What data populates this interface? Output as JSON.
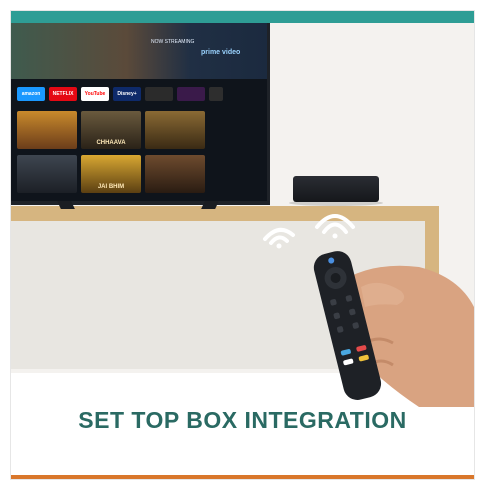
{
  "banner": {
    "title": "SET TOP BOX INTEGRATION"
  },
  "tv_screen": {
    "apps": [
      "amazon",
      "NETFLIX",
      "YouTube",
      "Disney+",
      "",
      "",
      ""
    ],
    "tiles_row1": [
      "",
      "CHHAAVA",
      ""
    ],
    "tiles_row2": [
      "",
      "JAI BHIM",
      ""
    ],
    "hero_text": "NOW STREAMING",
    "hero_brand": "prime video"
  },
  "colors": {
    "top_band": "#2e9d95",
    "bottom_band": "#d9772b",
    "title": "#2a6a63",
    "netflix": "#e50914",
    "youtube": "#ff0000"
  },
  "icons": [
    "wifi-signal-icon",
    "settop-box-icon",
    "remote-control-icon"
  ]
}
